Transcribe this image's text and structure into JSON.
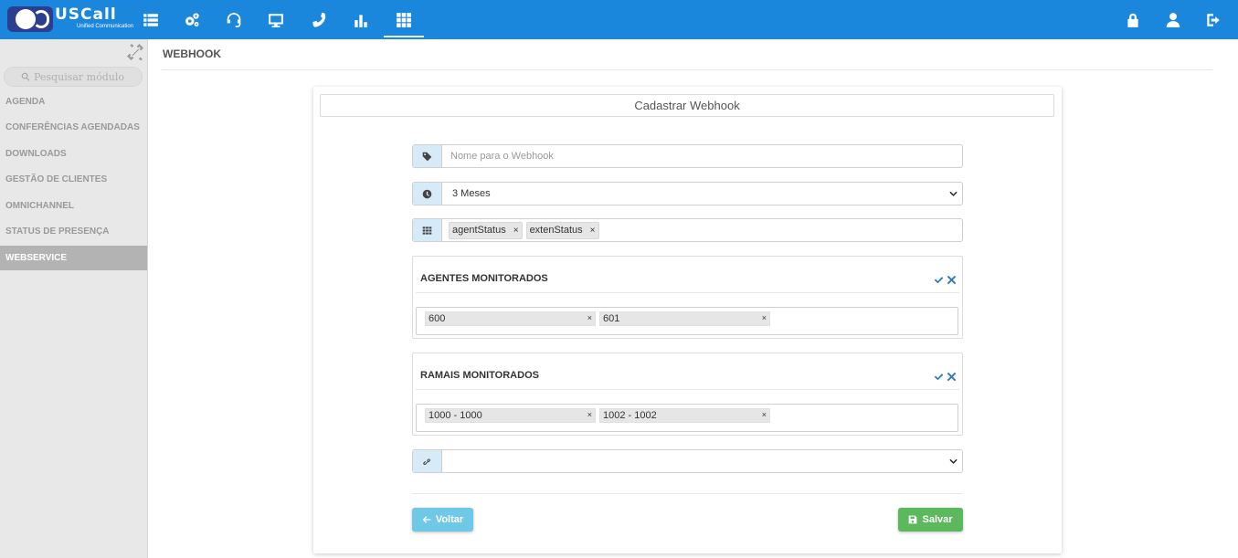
{
  "app": {
    "brand": "USCall",
    "tagline": "Unified Communication"
  },
  "topnav": {
    "items": [
      {
        "icon": "list-icon"
      },
      {
        "icon": "gears-icon"
      },
      {
        "icon": "headset-icon"
      },
      {
        "icon": "monitor-icon"
      },
      {
        "icon": "phone-icon"
      },
      {
        "icon": "bar-chart-icon"
      },
      {
        "icon": "grid-icon",
        "active": true
      }
    ],
    "right": [
      {
        "icon": "lock-icon"
      },
      {
        "icon": "user-icon"
      },
      {
        "icon": "logout-icon"
      }
    ],
    "color": "#1a86dc"
  },
  "sidebar": {
    "search_placeholder": "Pesquisar módulo",
    "items": [
      {
        "label": "AGENDA"
      },
      {
        "label": "CONFERÊNCIAS AGENDADAS"
      },
      {
        "label": "DOWNLOADS"
      },
      {
        "label": "GESTÃO DE CLIENTES"
      },
      {
        "label": "OMNICHANNEL"
      },
      {
        "label": "STATUS DE PRESENÇA"
      },
      {
        "label": "WEBSERVICE",
        "active": true
      }
    ]
  },
  "page": {
    "title": "WEBHOOK"
  },
  "form": {
    "heading": "Cadastrar Webhook",
    "name_placeholder": "Nome para o Webhook",
    "name_value": "",
    "period_value": "3 Meses",
    "events": [
      "agentStatus",
      "extenStatus"
    ],
    "agents": {
      "title": "AGENTES MONITORADOS",
      "items": [
        "600",
        "601"
      ]
    },
    "extensions": {
      "title": "RAMAIS MONITORADOS",
      "items": [
        "1000 - 1000",
        "1002 - 1002"
      ]
    },
    "url_value": "",
    "remove_symbol": "×",
    "back_label": "Voltar",
    "save_label": "Salvar"
  }
}
